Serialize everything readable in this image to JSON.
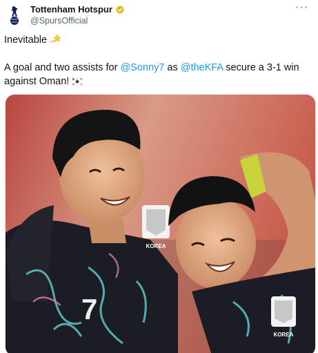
{
  "account": {
    "display_name": "Tottenham Hotspur",
    "handle": "@SpursOfficial",
    "avatar_icon": "tottenham-crest-icon",
    "verified_icon": "verified-gold-badge-icon",
    "verified_color": "#e2b719"
  },
  "more_label": "···",
  "tweet": {
    "line1": "Inevitable",
    "line1_emoji": "dizzy-star-emoji",
    "line2_part1": "A goal and two assists for ",
    "mention1": "@Sonny7",
    "line2_part2": " as ",
    "mention2": "@theKFA",
    "line2_part3": " secure a 3-1 win against Oman!",
    "flag_emoji": "south-korea-flag-emoji"
  },
  "media": {
    "description_icon": "photo-two-korea-players-celebrating",
    "jersey_text_left": "KOREA",
    "jersey_text_right": "KOREA",
    "jersey_number": "7"
  },
  "colors": {
    "link": "#1d9bf0",
    "text": "#0f1419",
    "muted": "#536471"
  }
}
